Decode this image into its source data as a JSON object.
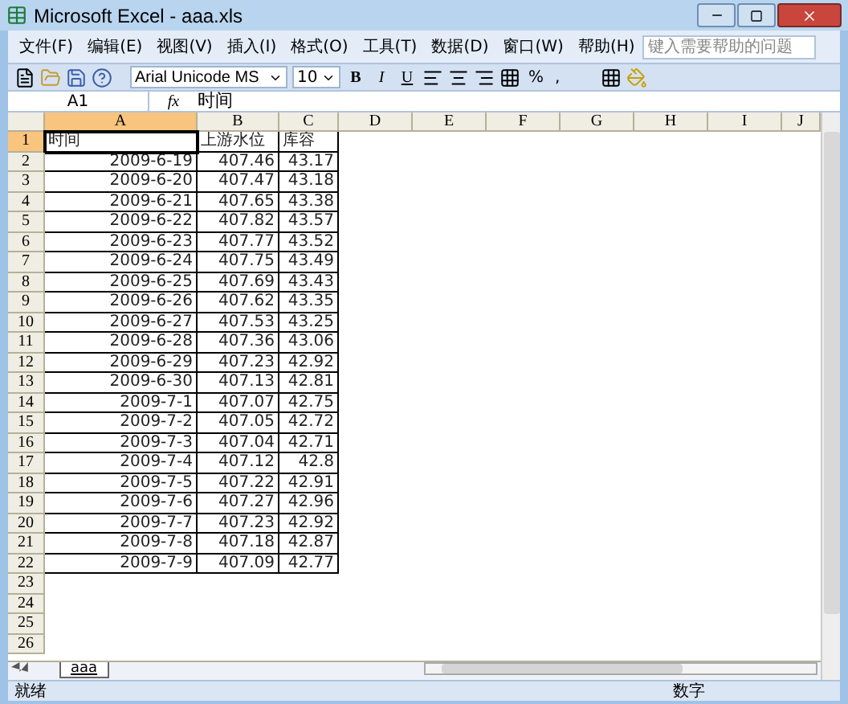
{
  "window": {
    "title": "Microsoft Excel - aaa.xls"
  },
  "menu": [
    {
      "label": "文件(F)"
    },
    {
      "label": "编辑(E)"
    },
    {
      "label": "视图(V)"
    },
    {
      "label": "插入(I)"
    },
    {
      "label": "格式(O)"
    },
    {
      "label": "工具(T)"
    },
    {
      "label": "数据(D)"
    },
    {
      "label": "窗口(W)"
    },
    {
      "label": "帮助(H)"
    }
  ],
  "help_search": {
    "placeholder": "键入需要帮助的问题"
  },
  "toolbar": {
    "font": "Arial Unicode MS",
    "size": "10",
    "format_buttons": [
      "B",
      "I",
      "U"
    ],
    "percent": "%",
    "comma": ","
  },
  "formula_bar": {
    "name_box": "A1",
    "fx": "fx",
    "value": "时间"
  },
  "columns": [
    {
      "label": "A",
      "selected": true
    },
    {
      "label": "B",
      "selected": false
    },
    {
      "label": "C",
      "selected": false
    },
    {
      "label": "D",
      "selected": false
    },
    {
      "label": "E",
      "selected": false
    },
    {
      "label": "F",
      "selected": false
    },
    {
      "label": "G",
      "selected": false
    },
    {
      "label": "H",
      "selected": false
    },
    {
      "label": "I",
      "selected": false
    },
    {
      "label": "J",
      "selected": false
    }
  ],
  "rows": [
    {
      "number": "1",
      "selected": true,
      "cells": [
        "时间",
        "上游水位",
        "库容"
      ]
    },
    {
      "number": "2",
      "selected": false,
      "cells": [
        "2009-6-19",
        "407.46",
        "43.17"
      ]
    },
    {
      "number": "3",
      "selected": false,
      "cells": [
        "2009-6-20",
        "407.47",
        "43.18"
      ]
    },
    {
      "number": "4",
      "selected": false,
      "cells": [
        "2009-6-21",
        "407.65",
        "43.38"
      ]
    },
    {
      "number": "5",
      "selected": false,
      "cells": [
        "2009-6-22",
        "407.82",
        "43.57"
      ]
    },
    {
      "number": "6",
      "selected": false,
      "cells": [
        "2009-6-23",
        "407.77",
        "43.52"
      ]
    },
    {
      "number": "7",
      "selected": false,
      "cells": [
        "2009-6-24",
        "407.75",
        "43.49"
      ]
    },
    {
      "number": "8",
      "selected": false,
      "cells": [
        "2009-6-25",
        "407.69",
        "43.43"
      ]
    },
    {
      "number": "9",
      "selected": false,
      "cells": [
        "2009-6-26",
        "407.62",
        "43.35"
      ]
    },
    {
      "number": "10",
      "selected": false,
      "cells": [
        "2009-6-27",
        "407.53",
        "43.25"
      ]
    },
    {
      "number": "11",
      "selected": false,
      "cells": [
        "2009-6-28",
        "407.36",
        "43.06"
      ]
    },
    {
      "number": "12",
      "selected": false,
      "cells": [
        "2009-6-29",
        "407.23",
        "42.92"
      ]
    },
    {
      "number": "13",
      "selected": false,
      "cells": [
        "2009-6-30",
        "407.13",
        "42.81"
      ]
    },
    {
      "number": "14",
      "selected": false,
      "cells": [
        "2009-7-1",
        "407.07",
        "42.75"
      ]
    },
    {
      "number": "15",
      "selected": false,
      "cells": [
        "2009-7-2",
        "407.05",
        "42.72"
      ]
    },
    {
      "number": "16",
      "selected": false,
      "cells": [
        "2009-7-3",
        "407.04",
        "42.71"
      ]
    },
    {
      "number": "17",
      "selected": false,
      "cells": [
        "2009-7-4",
        "407.12",
        "42.8"
      ]
    },
    {
      "number": "18",
      "selected": false,
      "cells": [
        "2009-7-5",
        "407.22",
        "42.91"
      ]
    },
    {
      "number": "19",
      "selected": false,
      "cells": [
        "2009-7-6",
        "407.27",
        "42.96"
      ]
    },
    {
      "number": "20",
      "selected": false,
      "cells": [
        "2009-7-7",
        "407.23",
        "42.92"
      ]
    },
    {
      "number": "21",
      "selected": false,
      "cells": [
        "2009-7-8",
        "407.18",
        "42.87"
      ]
    },
    {
      "number": "22",
      "selected": false,
      "cells": [
        "2009-7-9",
        "407.09",
        "42.77"
      ]
    },
    {
      "number": "23",
      "selected": false,
      "cells": []
    },
    {
      "number": "24",
      "selected": false,
      "cells": []
    },
    {
      "number": "25",
      "selected": false,
      "cells": []
    },
    {
      "number": "26",
      "selected": false,
      "cells": []
    }
  ],
  "sheet_tabs": [
    {
      "label": "aaa",
      "selected": true
    }
  ],
  "status_bar": {
    "status": "就绪",
    "mode": "数字"
  }
}
